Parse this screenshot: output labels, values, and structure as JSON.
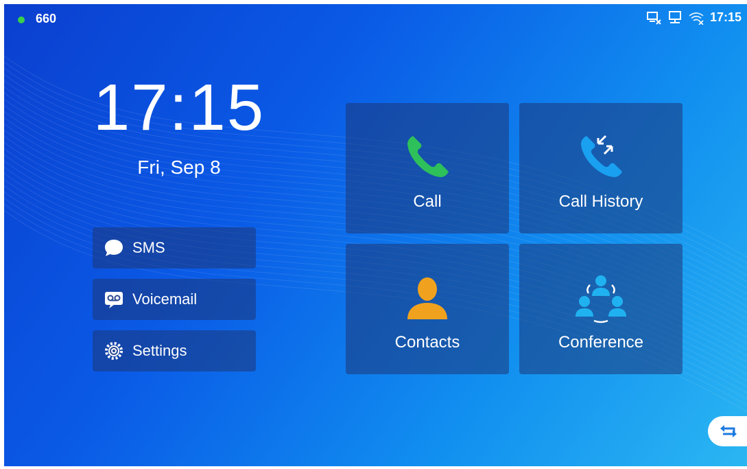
{
  "status_bar": {
    "extension": "660",
    "online_color": "#3ad04a",
    "icons": [
      "network-disconnected-icon",
      "computer-network-icon",
      "wifi-off-icon"
    ],
    "time": "17:15"
  },
  "clock": {
    "time": "17:15",
    "date": "Fri, Sep 8"
  },
  "side_menu": [
    {
      "label": "SMS",
      "icon": "sms-icon"
    },
    {
      "label": "Voicemail",
      "icon": "voicemail-icon"
    },
    {
      "label": "Settings",
      "icon": "settings-gear-icon"
    }
  ],
  "tiles": [
    {
      "label": "Call",
      "icon": "phone-icon",
      "icon_color": "#2ec05a"
    },
    {
      "label": "Call History",
      "icon": "call-history-icon",
      "icon_color": "#1aa0f0"
    },
    {
      "label": "Contacts",
      "icon": "contact-person-icon",
      "icon_color": "#f0a21e"
    },
    {
      "label": "Conference",
      "icon": "conference-icon",
      "icon_color": "#20b2f0"
    }
  ],
  "switch_button": {
    "icon": "switch-arrows-icon"
  },
  "colors": {
    "background_start": "#0b3fcf",
    "background_end": "#2bb6f2",
    "panel": "#1e3778"
  }
}
